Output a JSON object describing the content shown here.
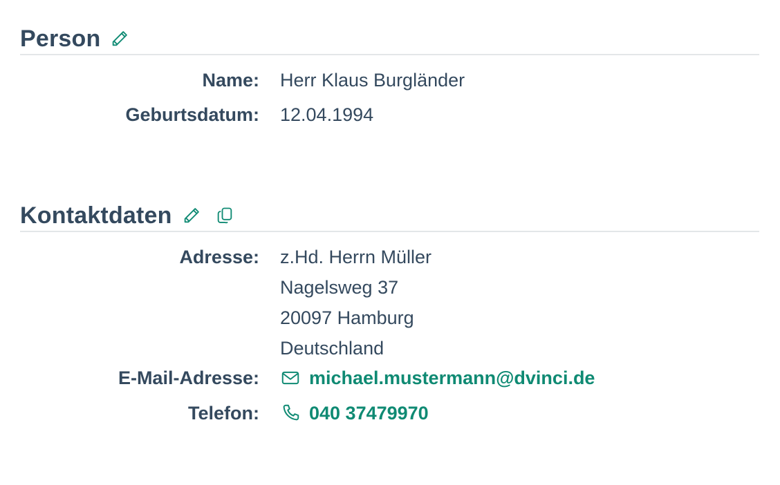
{
  "person": {
    "title": "Person",
    "rows": {
      "name": {
        "label": "Name:",
        "value": "Herr Klaus Burgländer"
      },
      "birthdate": {
        "label": "Geburtsdatum:",
        "value": "12.04.1994"
      }
    }
  },
  "contact": {
    "title": "Kontaktdaten",
    "address": {
      "label": "Adresse:",
      "lines": [
        "z.Hd. Herrn Müller",
        "Nagelsweg 37",
        "20097 Hamburg",
        "Deutschland"
      ]
    },
    "email": {
      "label": "E-Mail-Adresse:",
      "value": "michael.mustermann@dvinci.de"
    },
    "phone": {
      "label": "Telefon:",
      "value": "040 37479970"
    }
  },
  "icons": {
    "edit_person": "pencil-icon",
    "edit_contact": "pencil-icon",
    "copy_contact": "copy-icon",
    "email": "envelope-icon",
    "phone": "phone-icon"
  },
  "colors": {
    "text": "#34495e",
    "accent": "#0f8a73",
    "divider": "#e3e6e8"
  }
}
